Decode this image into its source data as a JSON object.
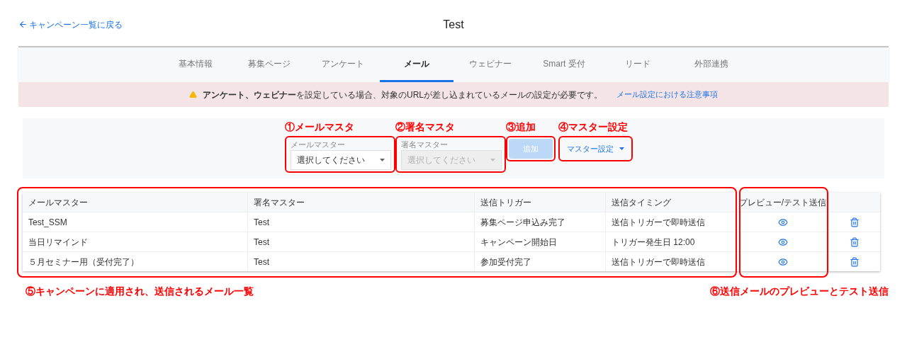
{
  "back_link": "キャンペーン一覧に戻る",
  "title": "Test",
  "tabs": [
    {
      "label": "基本情報",
      "selected": false
    },
    {
      "label": "募集ページ",
      "selected": false
    },
    {
      "label": "アンケート",
      "selected": false
    },
    {
      "label": "メール",
      "selected": true
    },
    {
      "label": "ウェビナー",
      "selected": false
    },
    {
      "label": "Smart 受付",
      "selected": false
    },
    {
      "label": "リード",
      "selected": false
    },
    {
      "label": "外部連携",
      "selected": false
    }
  ],
  "banner": {
    "message": "**アンケート、ウェビナー**を設定している場合、対象のURLが差し込まれているメールの設定が必要です。",
    "link": "メール設定における注意事項"
  },
  "form": {
    "controls": [
      {
        "kind": "select",
        "annotation": "①メールマスタ",
        "label": "メールマスター",
        "value": "選択してください",
        "disabled": false
      },
      {
        "kind": "select",
        "annotation": "②署名マスタ",
        "label": "署名マスター",
        "value": "選択してください",
        "disabled": true
      },
      {
        "kind": "button",
        "annotation": "③追加",
        "label": "追加",
        "disabled": true
      },
      {
        "kind": "menu_button",
        "annotation": "④マスター設定",
        "label": "マスター設定",
        "disabled": false
      }
    ]
  },
  "table": {
    "columns": [
      "メールマスター",
      "署名マスター",
      "送信トリガー",
      "送信タイミング",
      "プレビュー/テスト送信"
    ],
    "rows": [
      {
        "cells": [
          "Test_SSM",
          "Test",
          "募集ページ申込み完了",
          "送信トリガーで即時送信"
        ]
      },
      {
        "cells": [
          "当日リマインド",
          "Test",
          "キャンペーン開始日",
          "トリガー発生日 12:00"
        ]
      },
      {
        "cells": [
          "５月セミナー用（受付完了）",
          "Test",
          "参加受付完了",
          "送信トリガーで即時送信"
        ]
      }
    ]
  },
  "annotations": {
    "table": "⑤キャンペーンに適用され、送信されるメール一覧",
    "preview": "⑥送信メールのプレビューとテスト送信"
  }
}
